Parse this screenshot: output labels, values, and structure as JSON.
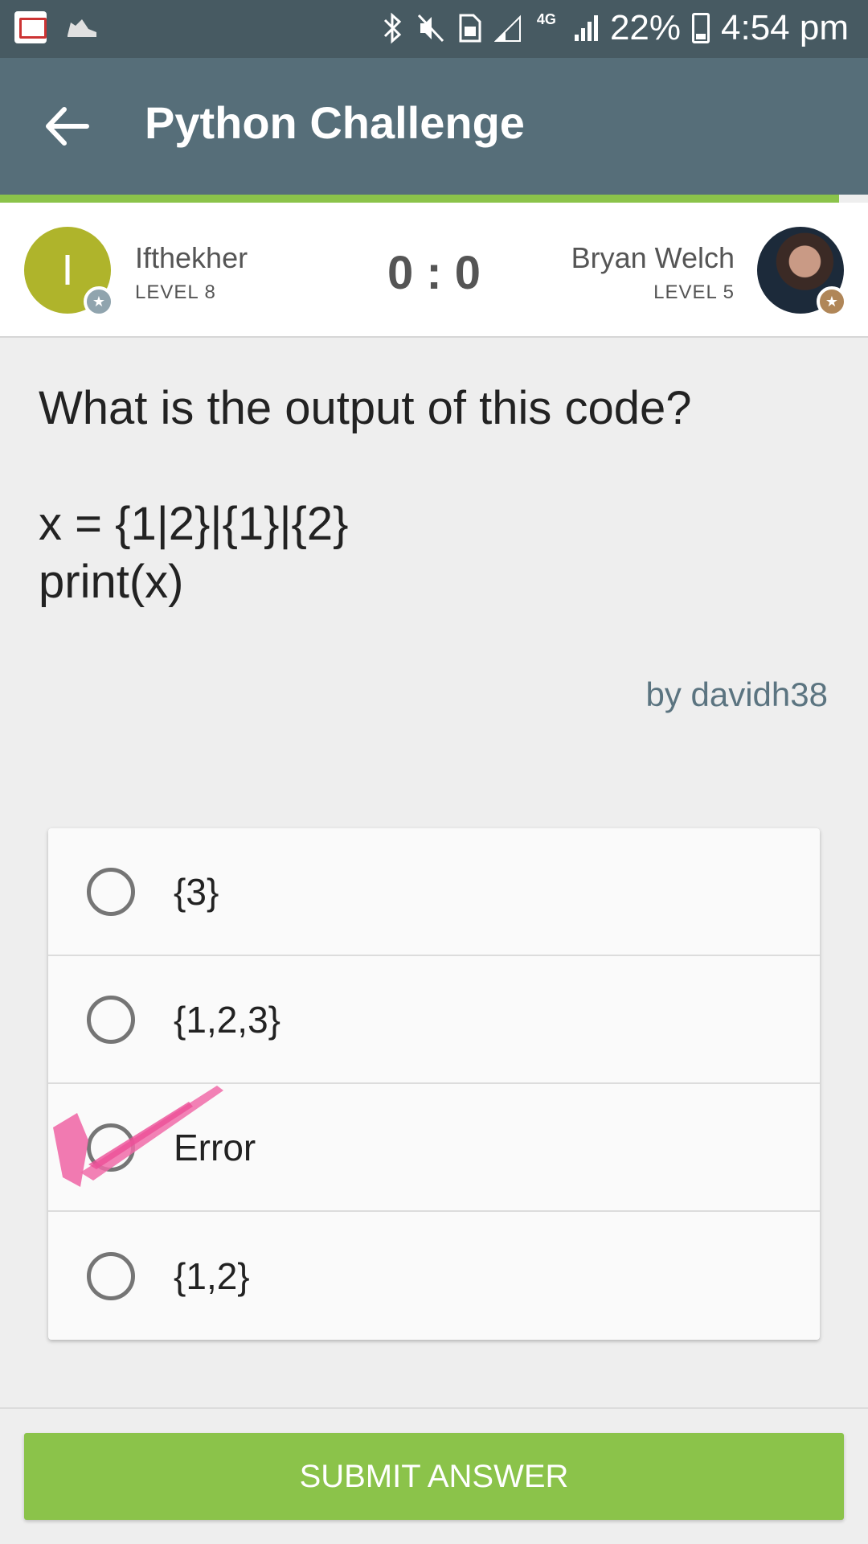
{
  "status_bar": {
    "icons": [
      "news-app-icon",
      "shoe-app-icon",
      "bluetooth-icon",
      "mute-icon",
      "sim-icon",
      "signal-icon",
      "4g-icon",
      "signal-icon",
      "battery-icon"
    ],
    "battery": "22%",
    "time": "4:54 pm",
    "network": "4G"
  },
  "app_bar": {
    "title": "Python Challenge",
    "back_icon": "arrow-left-icon",
    "color": "#566e79"
  },
  "players": {
    "left": {
      "name": "Ifthekher",
      "level": "LEVEL 8",
      "initial": "I",
      "avatar_color": "#afb42b"
    },
    "right": {
      "name": "Bryan Welch",
      "level": "LEVEL 5"
    },
    "score": "0 : 0"
  },
  "question": {
    "text": "What is the output of this code?\n\nx = {1|2}|{1}|{2}\nprint(x)",
    "author": "by davidh38"
  },
  "options": [
    {
      "label": "{3}"
    },
    {
      "label": "{1,2,3}"
    },
    {
      "label": "Error"
    },
    {
      "label": "{1,2}"
    }
  ],
  "submit": {
    "label": "SUBMIT ANSWER",
    "color": "#8bc34a"
  }
}
